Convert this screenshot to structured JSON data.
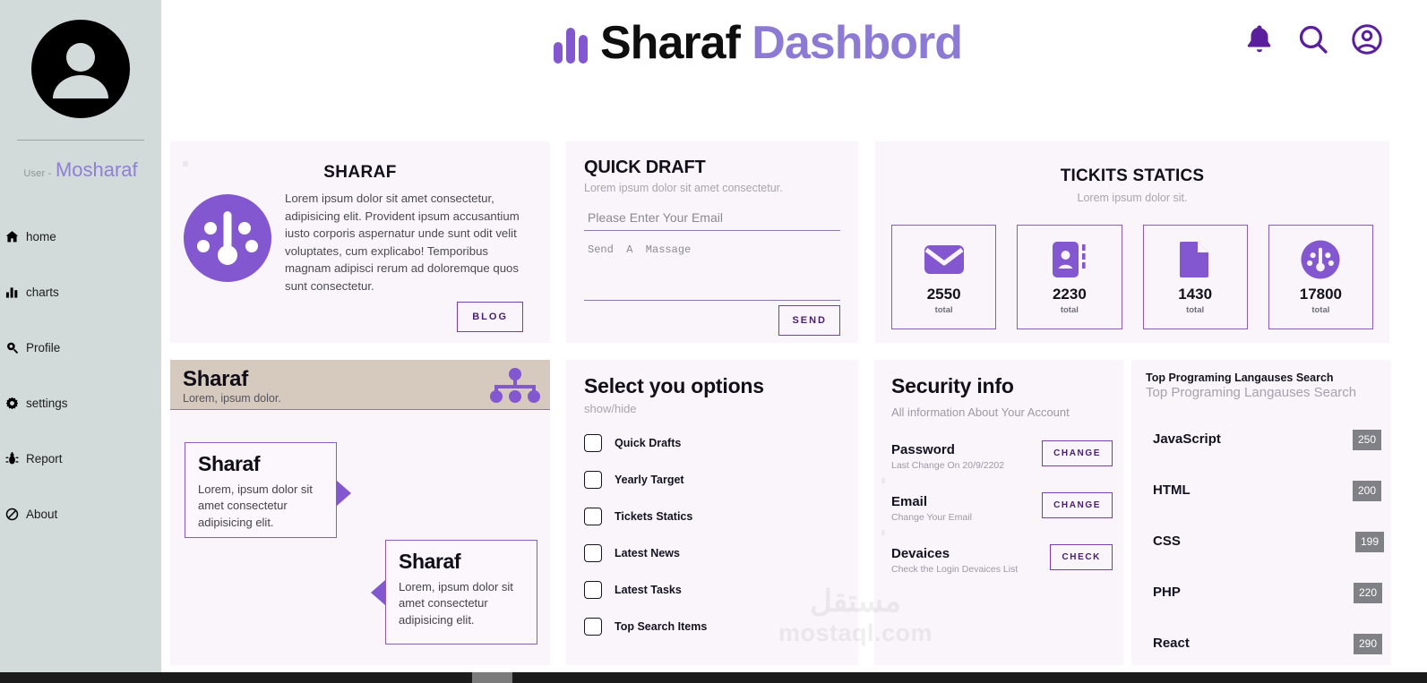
{
  "sidebar": {
    "avatar_icon": "user-avatar-icon",
    "user_label": "User -",
    "user_name": "Mosharaf",
    "items": [
      {
        "label": "home",
        "icon": "home-icon"
      },
      {
        "label": "charts",
        "icon": "bar-chart-icon"
      },
      {
        "label": "Profile",
        "icon": "search-profile-icon"
      },
      {
        "label": "settings",
        "icon": "gear-icon"
      },
      {
        "label": "Report",
        "icon": "bug-icon"
      },
      {
        "label": "About",
        "icon": "no-entry-icon"
      }
    ]
  },
  "header": {
    "logo_icon": "bar-chart-logo-icon",
    "title_part1": "Sharaf",
    "title_part2": "Dashbord",
    "actions": [
      {
        "name": "notifications-bell-icon"
      },
      {
        "name": "search-icon"
      },
      {
        "name": "account-circle-icon"
      }
    ]
  },
  "sharaf_card": {
    "title": "SHARAF",
    "icon": "gauge-icon",
    "paragraph": "Lorem ipsum dolor sit amet consectetur, adipisicing elit. Provident ipsum accusantium iusto corporis aspernatur unde sunt odit velit voluptates, cum explicabo! Temporibus magnam adipisci rerum ad doloremque quos sunt consectetur.",
    "button": "BLOG"
  },
  "quick_draft": {
    "title": "QUICK DRAFT",
    "subtitle": "Lorem ipsum dolor sit amet consectetur.",
    "email_placeholder": "Please Enter Your Email",
    "email_value": "",
    "message_placeholder": "Send  A  Massage",
    "message_value": "",
    "button": "SEND"
  },
  "tickets": {
    "title": "TICKITS STATICS",
    "subtitle": "Lorem ipsum dolor sit.",
    "tiles": [
      {
        "icon": "envelope-icon",
        "value": "2550",
        "caption": "total"
      },
      {
        "icon": "contact-card-icon",
        "value": "2230",
        "caption": "total"
      },
      {
        "icon": "document-icon",
        "value": "1430",
        "caption": "total"
      },
      {
        "icon": "gauge-icon",
        "value": "17800",
        "caption": "total"
      }
    ]
  },
  "slider_card": {
    "header_title": "Sharaf",
    "header_subtitle": "Lorem, ipsum dolor.",
    "header_icon": "sitemap-icon",
    "slides": [
      {
        "title": "Sharaf",
        "text": "Lorem, ipsum dolor sit amet consectetur adipisicing elit."
      },
      {
        "title": "Sharaf",
        "text": "Lorem, ipsum dolor sit amet consectetur adipisicing elit."
      }
    ]
  },
  "options": {
    "title": "Select you options",
    "subtitle": "show/hide",
    "items": [
      {
        "label": "Quick Drafts",
        "checked": false
      },
      {
        "label": "Yearly Target",
        "checked": false
      },
      {
        "label": "Tickets Statics",
        "checked": false
      },
      {
        "label": "Latest News",
        "checked": false
      },
      {
        "label": "Latest Tasks",
        "checked": false
      },
      {
        "label": "Top Search Items",
        "checked": false
      }
    ]
  },
  "security": {
    "title": "Security info",
    "subtitle": "All information About Your Account",
    "rows": [
      {
        "name": "Password",
        "desc": "Last Change On 20/9/2202",
        "button": "CHANGE"
      },
      {
        "name": "Email",
        "desc": "Change Your Email",
        "button": "CHANGE"
      },
      {
        "name": "Devaices",
        "desc": "Check the Login Devaices List",
        "button": "CHECK"
      }
    ]
  },
  "languages": {
    "title": "Top Programing Langauses Search",
    "subtitle": "Top Programing Langauses Search",
    "rows": [
      {
        "name": "JavaScript",
        "value": "250"
      },
      {
        "name": "HTML",
        "value": "200"
      },
      {
        "name": "CSS",
        "value": "199"
      },
      {
        "name": "PHP",
        "value": "220"
      },
      {
        "name": "React",
        "value": "290"
      }
    ]
  },
  "watermark": {
    "arabic": "مستقل",
    "latin": "mostaql.com"
  },
  "colors": {
    "accent_purple": "#8257cf",
    "deep_purple": "#5b1f9e",
    "card_bg": "#f9f5fb",
    "sidebar_bg": "#d2dbd9",
    "slider_head": "#d6c9bd",
    "badge_gray": "#808087"
  }
}
